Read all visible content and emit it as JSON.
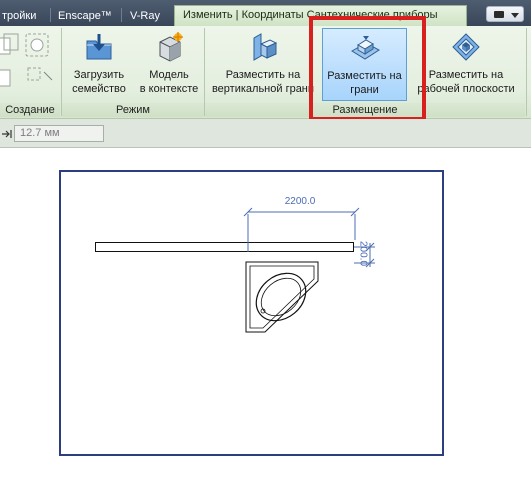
{
  "tabs": {
    "items": [
      "тройки",
      "Enscape™",
      "V-Ray"
    ],
    "active": "Изменить | Координаты Сантехнические приборы"
  },
  "ribbon": {
    "panels": {
      "create": "Создание",
      "mode": "Режим",
      "placement": "Размещение"
    },
    "buttons": {
      "load_family": [
        "Загрузить",
        "семейство"
      ],
      "model_in_context": [
        "Модель",
        "в контексте"
      ],
      "place_vertical_face": [
        "Разместить на",
        "вертикальной грани"
      ],
      "place_on_face": [
        "Разместить на",
        "грани"
      ],
      "place_work_plane": [
        "Разместить на",
        "рабочей плоскости"
      ]
    },
    "selected_button": "place_on_face"
  },
  "options_bar": {
    "offset_value": "12.7 мм"
  },
  "drawing": {
    "dimension_horizontal": "2200.0",
    "dimension_vertical": "200.0"
  },
  "colors": {
    "tab_bar": "#404d61",
    "ribbon_bg": "#e6f0e1",
    "selection_fill": "#b9dcfc",
    "highlight_box": "#d8201f",
    "sheet_border": "#2d3e7e",
    "dimension": "#4c6cb3"
  }
}
